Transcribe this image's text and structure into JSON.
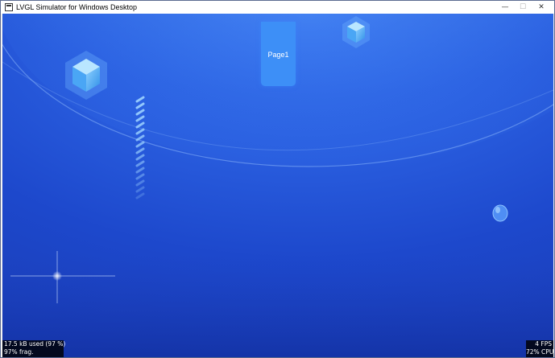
{
  "window": {
    "title": "LVGL Simulator for Windows Desktop",
    "controls": {
      "minimize": "—",
      "maximize": "☐",
      "close": "✕"
    }
  },
  "screen": {
    "page_button_label": "Page1",
    "colors": {
      "background_top": "#3a78f0",
      "background_bottom": "#1a3cb4",
      "accent": "#3d8ff7"
    }
  },
  "monitor": {
    "memory_used": "17.5 kB used (97 %)",
    "fragmentation": "97% frag.",
    "fps": "4 FPS",
    "cpu": "72% CPU"
  }
}
